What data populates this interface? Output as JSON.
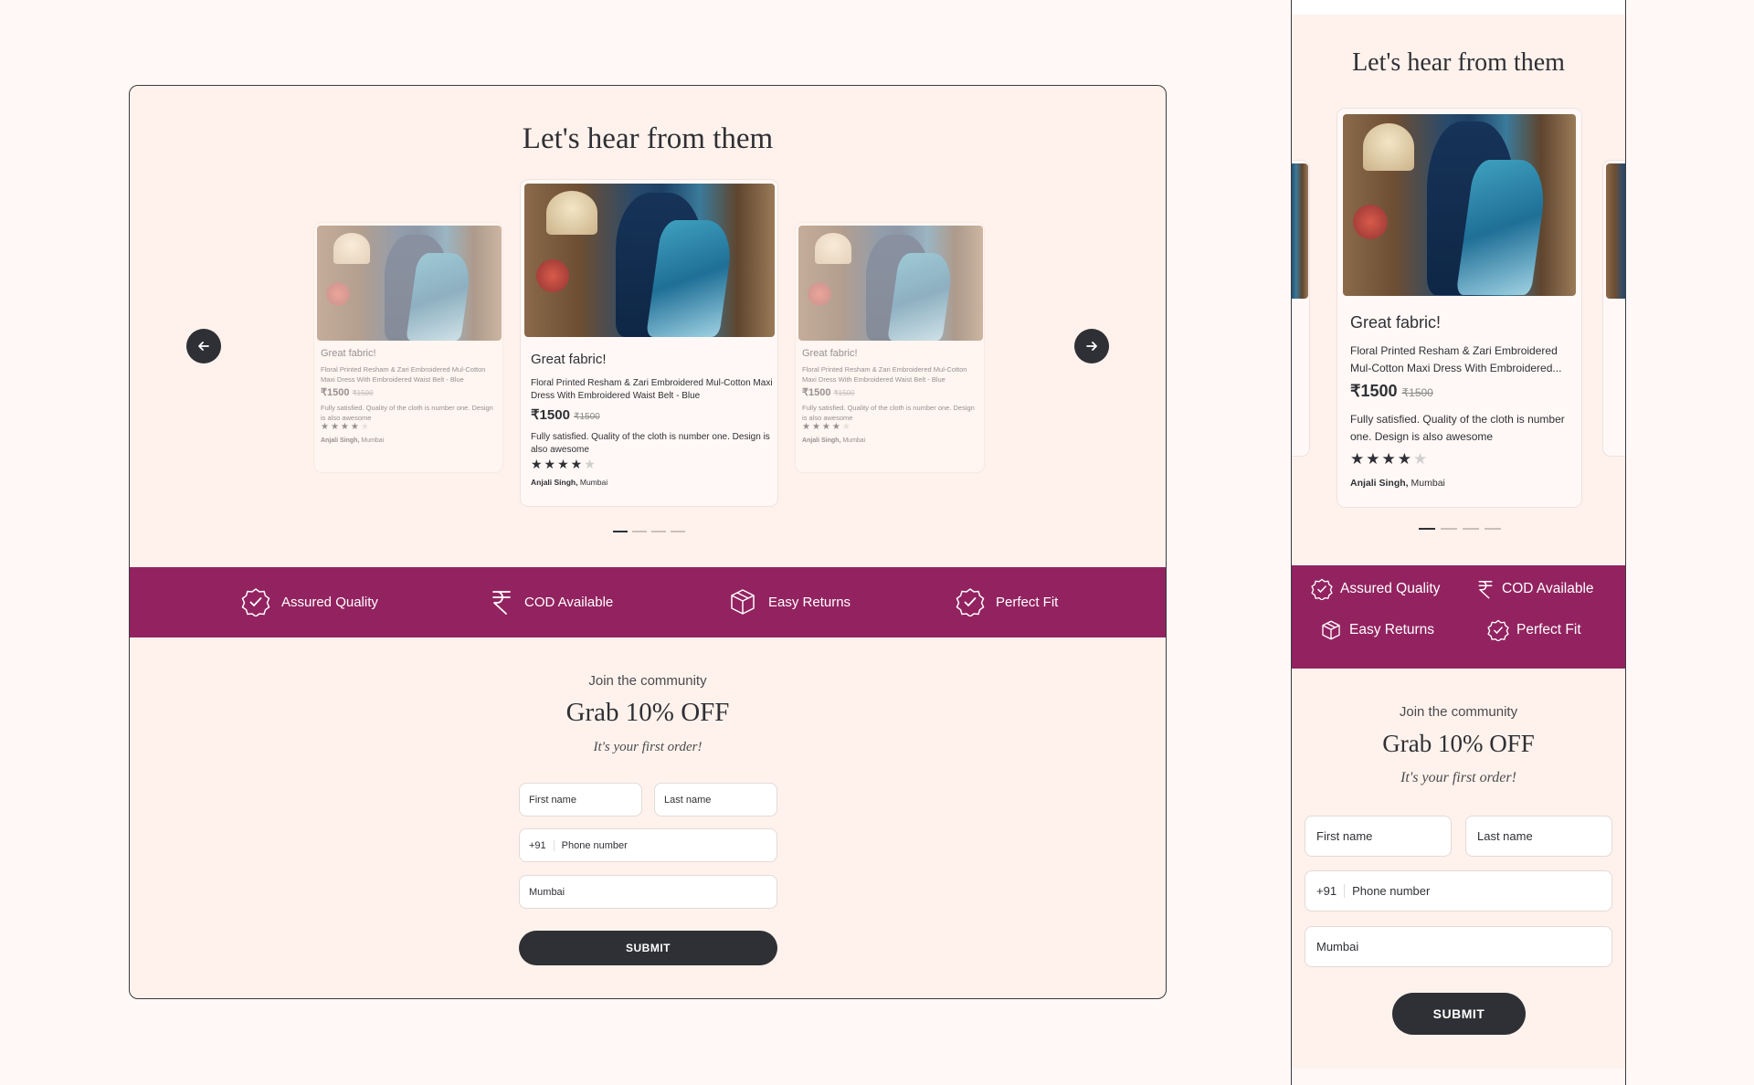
{
  "section_title": "Let's hear from them",
  "review": {
    "title": "Great fabric!",
    "product": "Floral Printed Resham & Zari Embroidered Mul-Cotton Maxi Dress With Embroidered Waist Belt - Blue",
    "product_truncated": "Floral Printed Resham & Zari Embroidered Mul-Cotton Maxi Dress With Embroidered...",
    "price": "₹1500",
    "old_price": "₹1500",
    "text": "Fully satisfied. Quality of the cloth is number one. Design is also awesome",
    "rating": 4,
    "max_rating": 5,
    "author": "Anjali Singh,",
    "location": "Mumbai"
  },
  "carousel": {
    "prev_icon": "arrow-left-icon",
    "next_icon": "arrow-right-icon",
    "dot_count": 4,
    "active_dot": 0
  },
  "features": [
    {
      "label": "Assured Quality",
      "icon": "badge-check-icon"
    },
    {
      "label": "COD Available",
      "icon": "rupee-icon"
    },
    {
      "label": "Easy Returns",
      "icon": "box-icon"
    },
    {
      "label": "Perfect Fit",
      "icon": "badge-check-icon"
    }
  ],
  "community": {
    "kicker": "Join the community",
    "headline": "Grab 10% OFF",
    "sub": "It's your first order!"
  },
  "form": {
    "first_name_placeholder": "First name",
    "last_name_placeholder": "Last name",
    "country_code": "+91",
    "phone_placeholder": "Phone number",
    "city_value": "Mumbai",
    "submit_label": "SUBMIT"
  },
  "colors": {
    "band": "#922360",
    "background": "#fff2ec",
    "dark": "#2f3035"
  }
}
